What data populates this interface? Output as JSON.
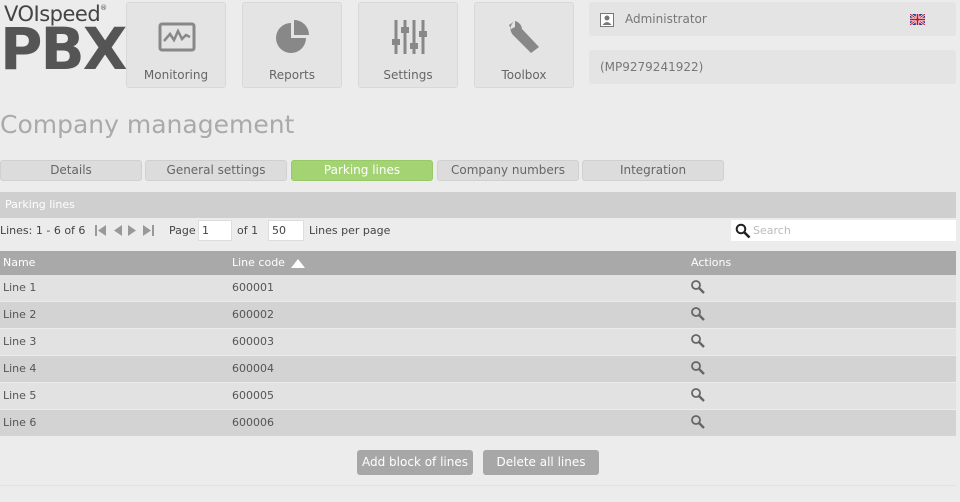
{
  "logo": {
    "top": "VOIspeed",
    "reg": "®",
    "main": "PBX"
  },
  "nav": [
    {
      "label": "Monitoring",
      "icon": "monitor-chart-icon"
    },
    {
      "label": "Reports",
      "icon": "pie-chart-icon"
    },
    {
      "label": "Settings",
      "icon": "sliders-icon"
    },
    {
      "label": "Toolbox",
      "icon": "wrench-icon"
    }
  ],
  "user": {
    "name": "Administrator",
    "account": "(MP9279241922)",
    "flag": "uk-flag-icon"
  },
  "page_title": "Company management",
  "tabs": [
    {
      "label": "Details",
      "active": false
    },
    {
      "label": "General settings",
      "active": false
    },
    {
      "label": "Parking lines",
      "active": true
    },
    {
      "label": "Company numbers",
      "active": false
    },
    {
      "label": "Integration",
      "active": false
    }
  ],
  "panel": {
    "title": "Parking lines",
    "lines_info": "Lines: 1 - 6 of 6",
    "page_label": "Page",
    "page_value": "1",
    "of_label": "of 1",
    "per_page_value": "50",
    "per_page_label": "Lines per page",
    "search_placeholder": "Search"
  },
  "table": {
    "columns": [
      "Name",
      "Line code",
      "Actions"
    ],
    "sort_column": "Line code",
    "rows": [
      {
        "name": "Line 1",
        "code": "600001"
      },
      {
        "name": "Line 2",
        "code": "600002"
      },
      {
        "name": "Line 3",
        "code": "600003"
      },
      {
        "name": "Line 4",
        "code": "600004"
      },
      {
        "name": "Line 5",
        "code": "600005"
      },
      {
        "name": "Line 6",
        "code": "600006"
      }
    ]
  },
  "buttons": {
    "add": "Add block of lines",
    "delete": "Delete all lines"
  },
  "colors": {
    "active_tab": "#a3d373",
    "header": "#a9a9a9",
    "button": "#a7a7a7"
  }
}
